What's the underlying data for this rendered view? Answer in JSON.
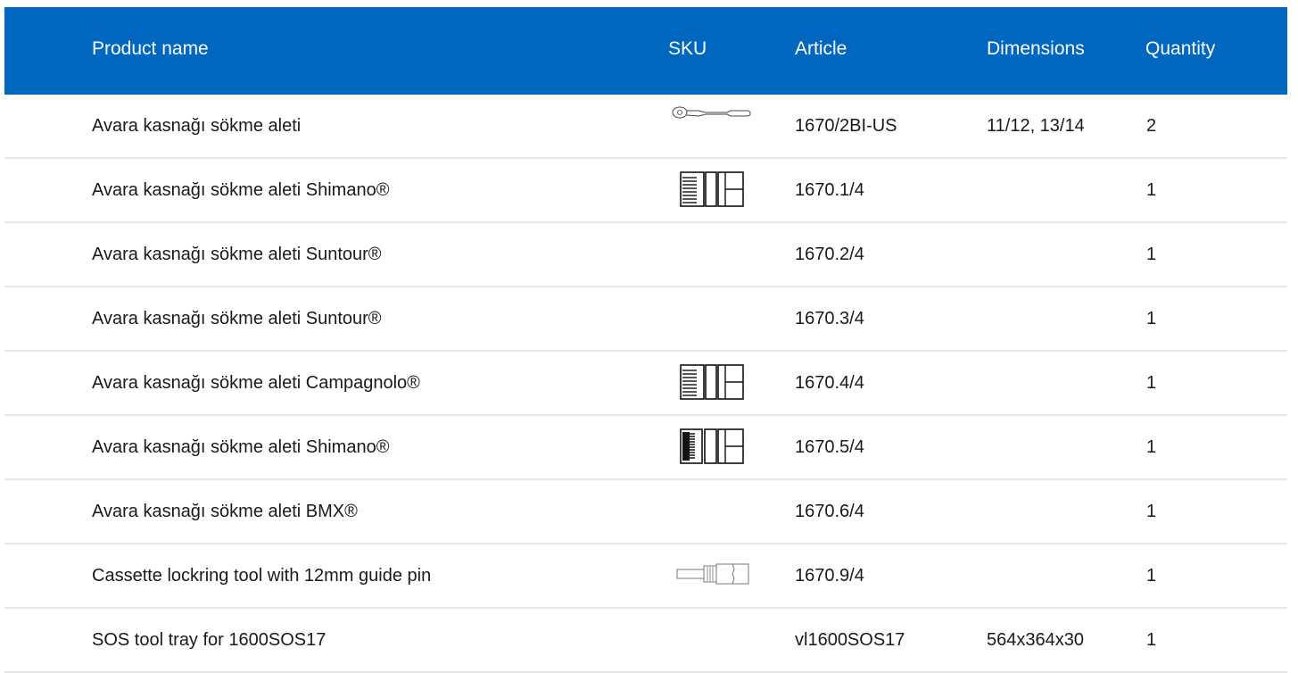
{
  "header": {
    "product_name": "Product name",
    "sku": "SKU",
    "article": "Article",
    "dimensions": "Dimensions",
    "quantity": "Quantity"
  },
  "rows": [
    {
      "name": "Avara kasnağı sökme aleti",
      "sku_icon": "ratchet-icon",
      "article": "1670/2BI-US",
      "dimensions": "11/12, 13/14",
      "quantity": "2"
    },
    {
      "name": "Avara kasnağı sökme aleti Shimano®",
      "sku_icon": "socket-tool-icon",
      "article": "1670.1/4",
      "dimensions": "",
      "quantity": "1"
    },
    {
      "name": "Avara kasnağı sökme aleti Suntour®",
      "sku_icon": "",
      "article": "1670.2/4",
      "dimensions": "",
      "quantity": "1"
    },
    {
      "name": "Avara kasnağı sökme aleti Suntour®",
      "sku_icon": "",
      "article": "1670.3/4",
      "dimensions": "",
      "quantity": "1"
    },
    {
      "name": "Avara kasnağı sökme aleti Campagnolo®",
      "sku_icon": "socket-tool-icon",
      "article": "1670.4/4",
      "dimensions": "",
      "quantity": "1"
    },
    {
      "name": "Avara kasnağı sökme aleti Shimano®",
      "sku_icon": "socket-tool-dense-icon",
      "article": "1670.5/4",
      "dimensions": "",
      "quantity": "1"
    },
    {
      "name": "Avara kasnağı sökme aleti BMX®",
      "sku_icon": "",
      "article": "1670.6/4",
      "dimensions": "",
      "quantity": "1"
    },
    {
      "name": "Cassette lockring tool with 12mm guide pin",
      "sku_icon": "lockring-tool-icon",
      "article": "1670.9/4",
      "dimensions": "",
      "quantity": "1"
    },
    {
      "name": "SOS tool tray for 1600SOS17",
      "sku_icon": "",
      "article": "vl1600SOS17",
      "dimensions": "564x364x30",
      "quantity": "1"
    }
  ],
  "colors": {
    "header_bg": "#0067c0",
    "header_text": "#ffffff",
    "row_divider": "#e6e6e6"
  }
}
